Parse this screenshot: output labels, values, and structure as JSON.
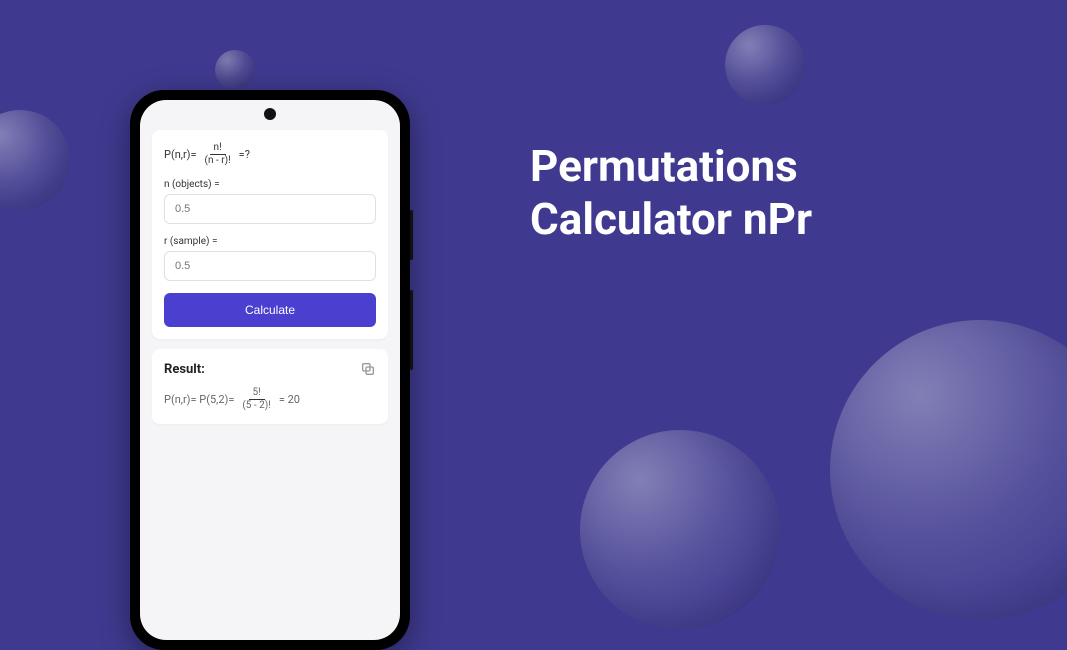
{
  "page": {
    "title_line1": "Permutations",
    "title_line2": "Calculator nPr"
  },
  "calculator": {
    "formula": {
      "lhs": "P(n,r)=",
      "numerator": "n!",
      "denominator": "(n - r)!",
      "rhs": "=?"
    },
    "n_label": "n (objects) =",
    "n_placeholder": "0.5",
    "r_label": "r (sample) =",
    "r_placeholder": "0.5",
    "calculate_label": "Calculate"
  },
  "result": {
    "title": "Result:",
    "lhs": "P(n,r)= P(5,2)=",
    "numerator": "5!",
    "denominator": "(5 - 2)!",
    "rhs": "= 20"
  }
}
